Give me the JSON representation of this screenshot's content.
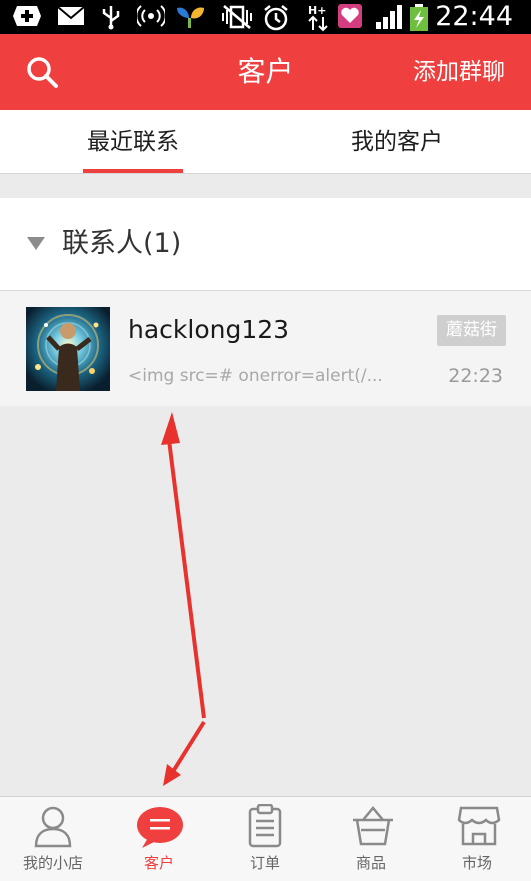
{
  "status_bar": {
    "time": "22:44",
    "icons": [
      "add-icon",
      "mail-icon",
      "usb-icon",
      "wifi-hotspot-icon",
      "app-icon",
      "vibrate-icon",
      "alarm-icon",
      "data-transfer-icon",
      "heart-app-icon",
      "signal-icon",
      "battery-icon"
    ]
  },
  "header": {
    "title": "客户",
    "action_label": "添加群聊",
    "background": "#ef3f3f"
  },
  "tabs": [
    {
      "label": "最近联系",
      "active": true
    },
    {
      "label": "我的客户",
      "active": false
    }
  ],
  "group": {
    "label": "联系人(1)"
  },
  "contacts": [
    {
      "name": "hacklong123",
      "tag": "蘑菇街",
      "message": "<img src=# onerror=alert(/...",
      "time": "22:23"
    }
  ],
  "bottom_nav": [
    {
      "label": "我的小店",
      "icon": "person-icon",
      "active": false
    },
    {
      "label": "客户",
      "icon": "chat-bubble-icon",
      "active": true
    },
    {
      "label": "订单",
      "icon": "clipboard-icon",
      "active": false
    },
    {
      "label": "商品",
      "icon": "basket-icon",
      "active": false
    },
    {
      "label": "市场",
      "icon": "storefront-icon",
      "active": false
    }
  ],
  "colors": {
    "accent": "#ef3f3f",
    "annotation": "#e8322d"
  }
}
